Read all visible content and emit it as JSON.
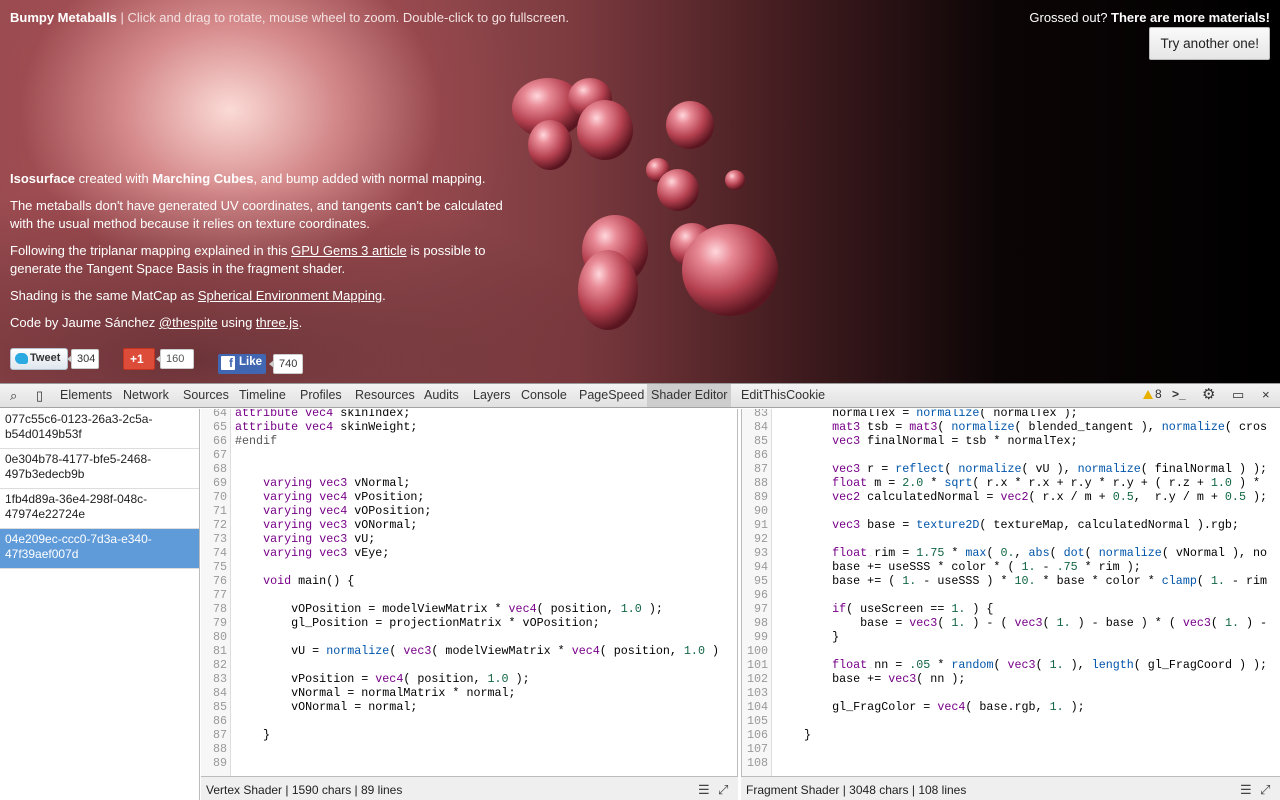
{
  "demo": {
    "title": "Bumpy Metaballs",
    "title_sep": " | ",
    "subtitle": "Click and drag to rotate, mouse wheel to zoom. Double-click to go fullscreen.",
    "grossed_prefix": "Grossed out? ",
    "grossed_bold": "There are more materials!",
    "try_button": "Try another one!",
    "p1_b1": "Isosurface",
    "p1_t1": " created with ",
    "p1_b2": "Marching Cubes",
    "p1_t2": ", and bump added with normal mapping.",
    "p2": "The metaballs don't have generated UV coordinates, and tangents can't be calculated with the usual method because it relies on texture coordinates.",
    "p3_t1": "Following the triplanar mapping explained in this ",
    "p3_link": "GPU Gems 3 article",
    "p3_t2": " is possible to generate the Tangent Space Basis in the fragment shader.",
    "p4_t1": "Shading is the same MatCap as ",
    "p4_link": "Spherical Environment Mapping",
    "p4_t2": ".",
    "p5_t1": "Code by Jaume Sánchez ",
    "p5_link1": "@thespite",
    "p5_t2": " using ",
    "p5_link2": "three.js",
    "p5_t3": ".",
    "social": {
      "tweet_label": "Tweet",
      "tweet_count": "304",
      "gplus_label": "+1",
      "gplus_count": "160",
      "like_label": "Like",
      "like_count": "740"
    }
  },
  "devtools": {
    "tabs": [
      "Elements",
      "Network",
      "Sources",
      "Timeline",
      "Profiles",
      "Resources",
      "Audits",
      "Layers",
      "Console",
      "PageSpeed",
      "Shader Editor",
      "EditThisCookie"
    ],
    "active_tab": "Shader Editor",
    "warning_count": "8",
    "programs": [
      "077c55c6-0123-26a3-2c5a-b54d0149b53f",
      "0e304b78-4177-bfe5-2468-497b3edecb9b",
      "1fb4d89a-36e4-298f-048c-47974e22724e",
      "04e209ec-ccc0-7d3a-e340-47f39aef007d"
    ],
    "selected_program": 3,
    "vertex_status": "Vertex Shader | 1590 chars | 89 lines",
    "fragment_status": "Fragment Shader | 3048 chars | 108 lines",
    "vertex_lines": [
      {
        "n": "64",
        "c": "attribute vec4 skinIndex;"
      },
      {
        "n": "65",
        "c": "attribute vec4 skinWeight;"
      },
      {
        "n": "66",
        "c": "#endif"
      },
      {
        "n": "67",
        "c": ""
      },
      {
        "n": "68",
        "c": ""
      },
      {
        "n": "69",
        "c": "    varying vec3 vNormal;"
      },
      {
        "n": "70",
        "c": "    varying vec4 vPosition;"
      },
      {
        "n": "71",
        "c": "    varying vec4 vOPosition;"
      },
      {
        "n": "72",
        "c": "    varying vec3 vONormal;"
      },
      {
        "n": "73",
        "c": "    varying vec3 vU;"
      },
      {
        "n": "74",
        "c": "    varying vec3 vEye;"
      },
      {
        "n": "75",
        "c": ""
      },
      {
        "n": "76",
        "c": "    void main() {"
      },
      {
        "n": "77",
        "c": ""
      },
      {
        "n": "78",
        "c": "        vOPosition = modelViewMatrix * vec4( position, 1.0 );"
      },
      {
        "n": "79",
        "c": "        gl_Position = projectionMatrix * vOPosition;"
      },
      {
        "n": "80",
        "c": ""
      },
      {
        "n": "81",
        "c": "        vU = normalize( vec3( modelViewMatrix * vec4( position, 1.0 )"
      },
      {
        "n": "82",
        "c": ""
      },
      {
        "n": "83",
        "c": "        vPosition = vec4( position, 1.0 );"
      },
      {
        "n": "84",
        "c": "        vNormal = normalMatrix * normal;"
      },
      {
        "n": "85",
        "c": "        vONormal = normal;"
      },
      {
        "n": "86",
        "c": ""
      },
      {
        "n": "87",
        "c": "    }"
      },
      {
        "n": "88",
        "c": ""
      },
      {
        "n": "89",
        "c": ""
      }
    ],
    "fragment_lines": [
      {
        "n": "83",
        "c": "        normalTex = normalize( normalTex );"
      },
      {
        "n": "84",
        "c": "        mat3 tsb = mat3( normalize( blended_tangent ), normalize( cros"
      },
      {
        "n": "85",
        "c": "        vec3 finalNormal = tsb * normalTex;"
      },
      {
        "n": "86",
        "c": ""
      },
      {
        "n": "87",
        "c": "        vec3 r = reflect( normalize( vU ), normalize( finalNormal ) );"
      },
      {
        "n": "88",
        "c": "        float m = 2.0 * sqrt( r.x * r.x + r.y * r.y + ( r.z + 1.0 ) *"
      },
      {
        "n": "89",
        "c": "        vec2 calculatedNormal = vec2( r.x / m + 0.5,  r.y / m + 0.5 );"
      },
      {
        "n": "90",
        "c": ""
      },
      {
        "n": "91",
        "c": "        vec3 base = texture2D( textureMap, calculatedNormal ).rgb;"
      },
      {
        "n": "92",
        "c": ""
      },
      {
        "n": "93",
        "c": "        float rim = 1.75 * max( 0., abs( dot( normalize( vNormal ), no"
      },
      {
        "n": "94",
        "c": "        base += useSSS * color * ( 1. - .75 * rim );"
      },
      {
        "n": "95",
        "c": "        base += ( 1. - useSSS ) * 10. * base * color * clamp( 1. - rim"
      },
      {
        "n": "96",
        "c": ""
      },
      {
        "n": "97",
        "c": "        if( useScreen == 1. ) {"
      },
      {
        "n": "98",
        "c": "            base = vec3( 1. ) - ( vec3( 1. ) - base ) * ( vec3( 1. ) -"
      },
      {
        "n": "99",
        "c": "        }"
      },
      {
        "n": "100",
        "c": ""
      },
      {
        "n": "101",
        "c": "        float nn = .05 * random( vec3( 1. ), length( gl_FragCoord ) );"
      },
      {
        "n": "102",
        "c": "        base += vec3( nn );"
      },
      {
        "n": "103",
        "c": ""
      },
      {
        "n": "104",
        "c": "        gl_FragColor = vec4( base.rgb, 1. );"
      },
      {
        "n": "105",
        "c": ""
      },
      {
        "n": "106",
        "c": "    }"
      },
      {
        "n": "107",
        "c": ""
      },
      {
        "n": "108",
        "c": ""
      }
    ]
  }
}
